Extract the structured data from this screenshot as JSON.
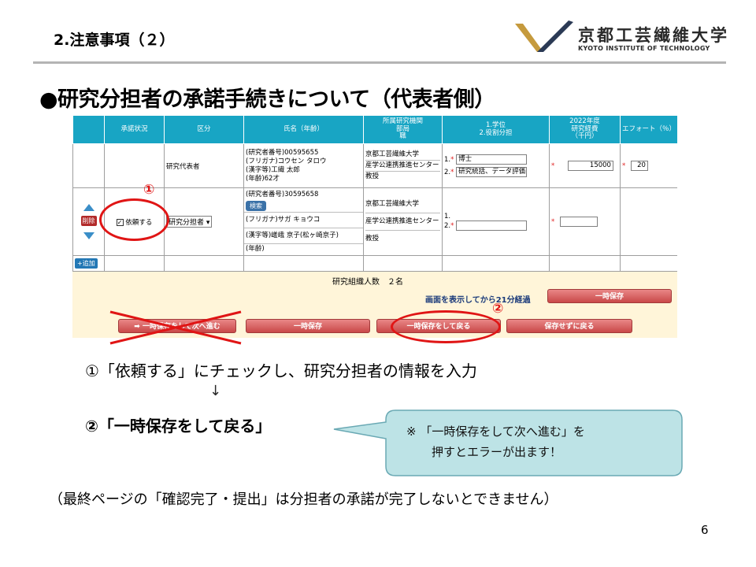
{
  "slide": {
    "section_title": "2.注意事項（２）",
    "headline": "●研究分担者の承諾手続きについて（代表者側）",
    "page_number": "6"
  },
  "logo": {
    "name_ja": "京都工芸繊維大学",
    "name_en": "KYOTO INSTITUTE OF TECHNOLOGY",
    "colors": {
      "dark": "#2b3a55",
      "gold": "#c59a3d"
    }
  },
  "form": {
    "headers": [
      "承諾状況",
      "区分",
      "氏名（年齢）",
      "所属研究機関\n部局\n職",
      "1.学位\n2.役割分担",
      "2022年度\n研究経費\n（千円）",
      "エフォート（％）"
    ],
    "row1": {
      "category": "研究代表者",
      "name_lines": [
        "(研究者番号)00595655",
        "(フリガナ)コウセン タロウ",
        "(漢字等)工繊 太郎",
        "(年齢)62才"
      ],
      "affiliation": [
        "京都工芸繊維大学",
        "産学公連携推進センター",
        "教授"
      ],
      "degree_no": "1.",
      "degree": "博士",
      "role_no": "2.",
      "role": "研究統括、データ評価",
      "budget": "15000",
      "effort": "20"
    },
    "row2": {
      "delete_label": "削除",
      "checkbox_label": "依頼する",
      "category_select": "研究分担者",
      "researcher_no": "(研究者番号)30595658",
      "search_label": "検索",
      "furigana": "(フリガナ)サガ キョウコ",
      "kanji": "(漢字等)嵯峨 京子(松ヶ崎京子)",
      "age": "(年齢)",
      "affiliation": [
        "京都工芸繊維大学",
        "産学公連携推進センター",
        "教授"
      ],
      "degree_no": "1.",
      "role_no": "2."
    },
    "add_label": "追加",
    "count_text": "研究組織人数　２名",
    "elapsed_text": "画面を表示してから21分経過",
    "buttons": {
      "temp_save_top": "一時保存",
      "save_next": "一時保存をして次へ進む",
      "temp_save": "一時保存",
      "save_return": "一時保存をして戻る",
      "return_no_save": "保存せずに戻る"
    },
    "required_mark": "*"
  },
  "annotations": {
    "mark1": "①",
    "mark2": "②",
    "step1": "①「依頼する」にチェックし、研究分担者の情報を入力",
    "arrow": "↓",
    "step2": "②「一時保存をして戻る」",
    "callout_line1": "※ 「一時保存をして次へ進む」を",
    "callout_line2": "押すとエラーが出ます！",
    "footnote": "（最終ページの「確認完了・提出」は分担者の承諾が完了しないとできません）"
  },
  "colors": {
    "header_teal": "#18a5c4",
    "highlight_red": "#e01515",
    "callout_fill": "#bde3e6",
    "callout_border": "#6aa9b4"
  }
}
